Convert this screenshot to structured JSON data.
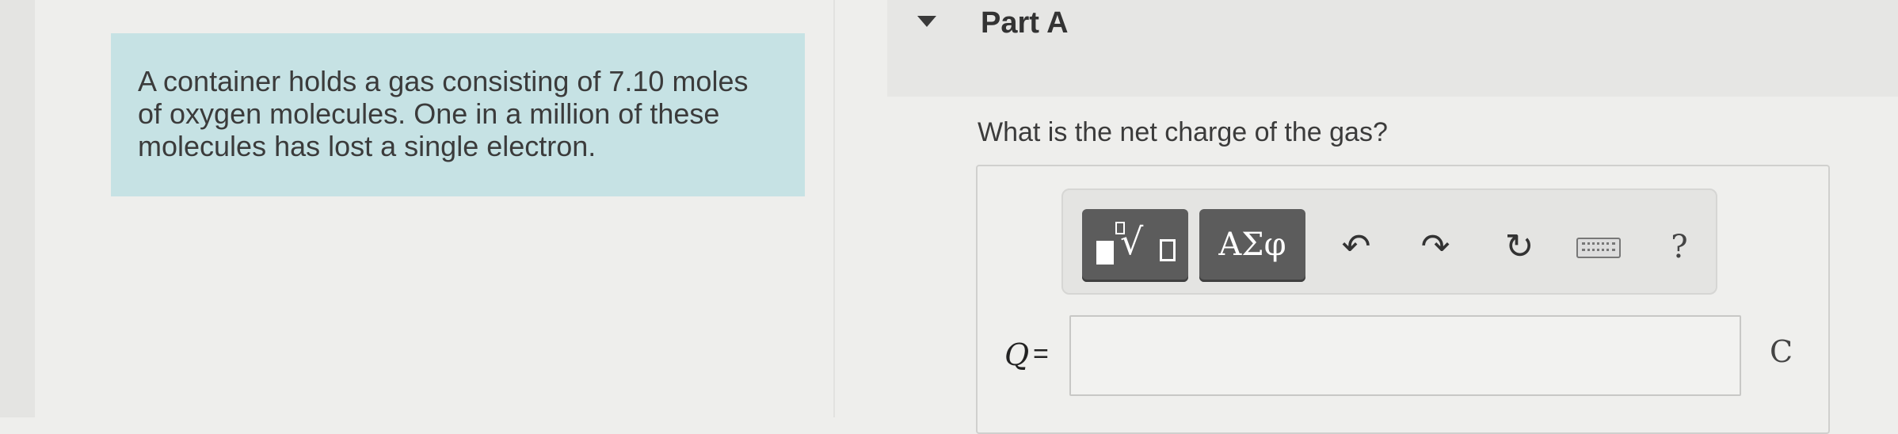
{
  "problem": {
    "text": "A container holds a gas consisting of 7.10 moles of oxygen molecules. One in a million of these molecules has lost a single electron."
  },
  "part": {
    "title": "Part A",
    "question": "What is the net charge of the gas?"
  },
  "toolbar": {
    "symbols_label": "ΑΣφ",
    "help_label": "?",
    "icons": [
      "templates-icon",
      "undo-icon",
      "redo-icon",
      "reset-icon",
      "keyboard-icon",
      "help-icon"
    ]
  },
  "answer": {
    "variable": "Q",
    "equals": "=",
    "value": "",
    "unit": "C"
  },
  "colors": {
    "info_box": "#c6e2e4",
    "toolbar_button": "#5c5c5c",
    "background": "#eeeeec"
  }
}
